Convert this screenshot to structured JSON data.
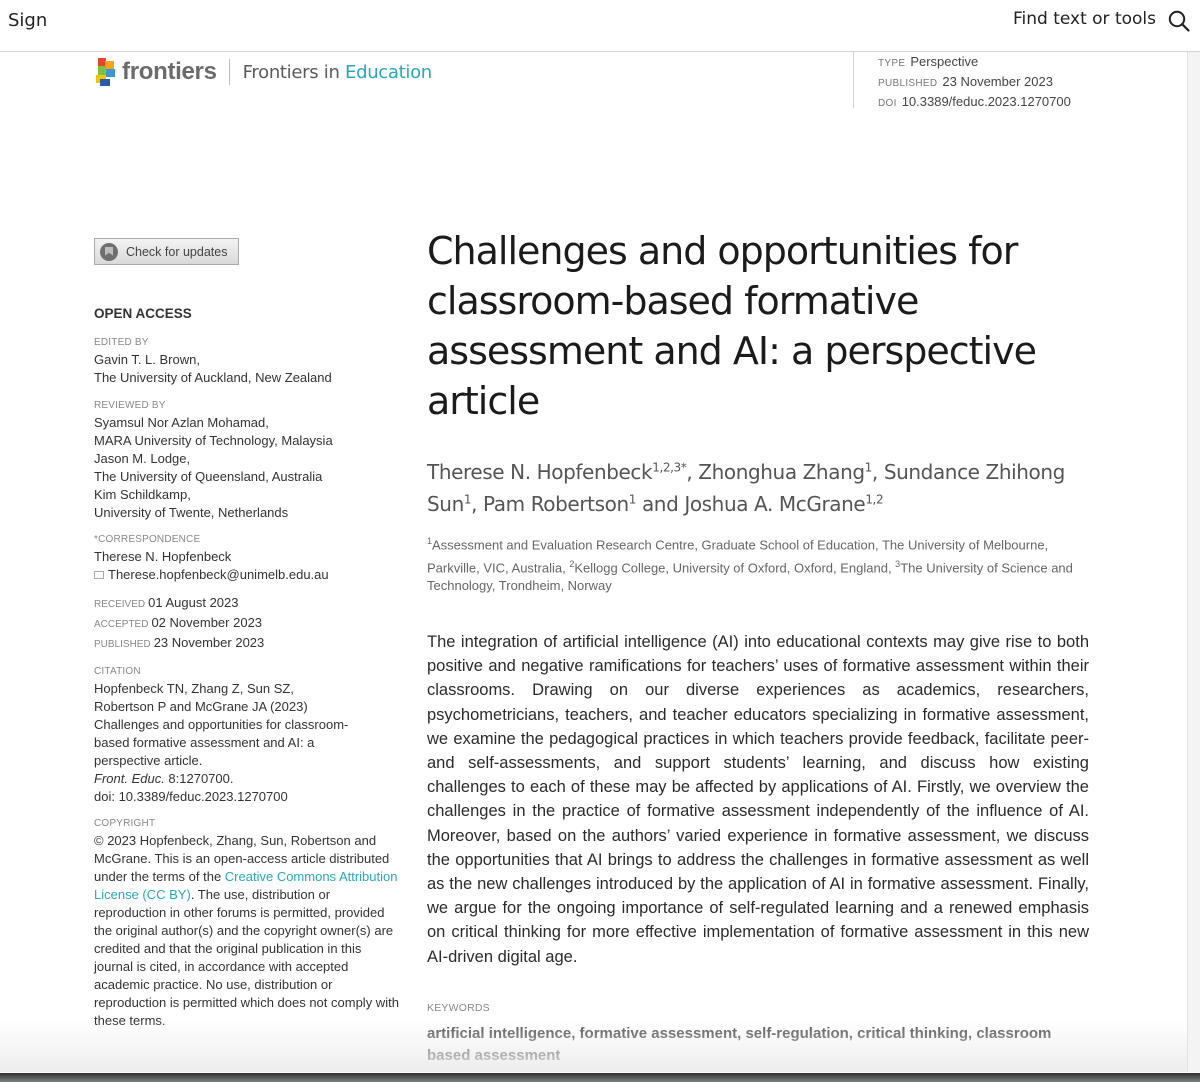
{
  "toolbar": {
    "sign_label": "Sign",
    "find_label": "Find text or tools",
    "search_icon": "search-icon"
  },
  "header": {
    "brand": "frontiers",
    "journal_prefix": "Frontiers in ",
    "journal_accent": "Education",
    "accent_color": "#2aa7b9",
    "meta": [
      {
        "label": "TYPE",
        "value": "Perspective"
      },
      {
        "label": "PUBLISHED",
        "value": "23 November 2023"
      },
      {
        "label": "DOI",
        "value": "10.3389/feduc.2023.1270700"
      }
    ]
  },
  "sidebar": {
    "check_updates": "Check for updates",
    "open_access": "OPEN ACCESS",
    "edited_by": {
      "label": "EDITED BY",
      "lines": [
        "Gavin T. L. Brown,",
        "The University of Auckland, New Zealand"
      ]
    },
    "reviewed_by": {
      "label": "REVIEWED BY",
      "lines": [
        "Syamsul Nor Azlan Mohamad,",
        "MARA University of Technology, Malaysia",
        "Jason M. Lodge,",
        "The University of Queensland, Australia",
        "Kim Schildkamp,",
        "University of Twente, Netherlands"
      ]
    },
    "correspondence": {
      "label": "*CORRESPONDENCE",
      "name": "Therese N. Hopfenbeck",
      "email": "Therese.hopfenbeck@unimelb.edu.au"
    },
    "dates": [
      {
        "label": "RECEIVED",
        "value": "01 August 2023"
      },
      {
        "label": "ACCEPTED",
        "value": "02 November 2023"
      },
      {
        "label": "PUBLISHED",
        "value": "23 November 2023"
      }
    ],
    "citation": {
      "label": "CITATION",
      "lines": [
        "Hopfenbeck TN, Zhang Z, Sun SZ,",
        "Robertson P and McGrane JA (2023)",
        "Challenges and opportunities for classroom-",
        "based formative assessment and AI: a",
        "perspective article."
      ],
      "journal_italic": "Front. Educ.",
      "volume": " 8:1270700.",
      "doi": "doi: 10.3389/feduc.2023.1270700"
    },
    "copyright": {
      "label": "COPYRIGHT",
      "text_before": "© 2023 Hopfenbeck, Zhang, Sun, Robertson and McGrane. This is an open-access article distributed under the terms of the ",
      "link": "Creative Commons Attribution License (CC BY)",
      "text_after": ". The use, distribution or reproduction in other forums is permitted, provided the original author(s) and the copyright owner(s) are credited and that the original publication in this journal is cited, in accordance with accepted academic practice. No use, distribution or reproduction is permitted which does not comply with these terms."
    }
  },
  "article": {
    "title": "Challenges and opportunities for classroom-based formative assessment and AI: a perspective article",
    "authors": [
      {
        "name": "Therese N. Hopfenbeck",
        "sup": "1,2,3*",
        "sep": ", "
      },
      {
        "name": "Zhonghua Zhang",
        "sup": "1",
        "sep": ", "
      },
      {
        "name": "Sundance Zhihong Sun",
        "sup": "1",
        "sep": ", "
      },
      {
        "name": "Pam Robertson",
        "sup": "1",
        "sep": " and "
      },
      {
        "name": "Joshua A. McGrane",
        "sup": "1,2",
        "sep": ""
      }
    ],
    "affiliations": [
      {
        "sup": "1",
        "text": "Assessment and Evaluation Research Centre, Graduate School of Education, The University of Melbourne, Parkville, VIC, Australia, "
      },
      {
        "sup": "2",
        "text": "Kellogg College, University of Oxford, Oxford, England, "
      },
      {
        "sup": "3",
        "text": "The University of Science and Technology, Trondheim, Norway"
      }
    ],
    "abstract": "The integration of artificial intelligence (AI) into educational contexts may give rise to both positive and negative ramifications for teachers’ uses of formative assessment within their classrooms. Drawing on our diverse experiences as academics, researchers, psychometricians, teachers, and teacher educators specializing in formative assessment, we examine the pedagogical practices in which teachers provide feedback, facilitate peer- and self-assessments, and support students’ learning, and discuss how existing challenges to each of these may be affected by applications of AI. Firstly, we overview the challenges in the practice of formative assessment independently of the influence of AI. Moreover, based on the authors’ varied experience in formative assessment, we discuss the opportunities that AI brings to address the challenges in formative assessment as well as the new challenges introduced by the application of AI in formative assessment. Finally, we argue for the ongoing importance of self-regulated learning and a renewed emphasis on critical thinking for more effective implementation of formative assessment in this new AI-driven digital age.",
    "keywords_label": "KEYWORDS",
    "keywords": "artificial intelligence, formative assessment, self-regulation, critical thinking, classroom based assessment"
  }
}
